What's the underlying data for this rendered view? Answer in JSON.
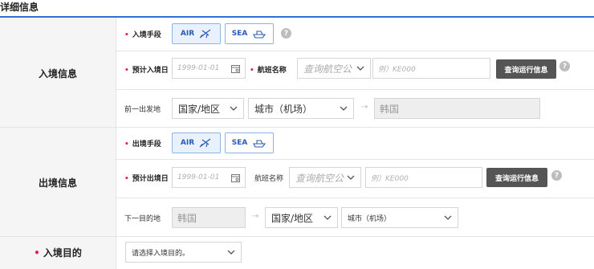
{
  "title": "详细信息",
  "entry": {
    "section_label": "入境信息",
    "mode_label": "入境手段",
    "air_label": "AIR",
    "sea_label": "SEA",
    "date_label": "预计入境日",
    "date_placeholder": "1999-01-01",
    "flight_label": "航班名称",
    "airline_select": "查询航空公",
    "flight_placeholder": "例）KE000",
    "query_button": "查询运行信息",
    "prev_label": "前一出发地",
    "country_select": "国家/地区",
    "city_select": "城市（机场）",
    "dest_value": "韩国"
  },
  "exit": {
    "section_label": "出境信息",
    "mode_label": "出境手段",
    "air_label": "AIR",
    "sea_label": "SEA",
    "date_label": "预计出境日",
    "date_placeholder": "1999-01-01",
    "flight_label": "航班名称",
    "airline_select": "查询航空公",
    "flight_placeholder": "例）KE000",
    "query_button": "查询运行信息",
    "next_label": "下一目的地",
    "origin_value": "韩国",
    "country_select": "国家/地区",
    "city_select": "城市（机场）"
  },
  "purpose": {
    "section_label": "入境目的",
    "select_placeholder": "请选择入境目的。"
  },
  "icons": {
    "help": "?",
    "arrow": "→",
    "calendar": "calendar-icon",
    "plane": "plane-icon",
    "ship": "ship-icon",
    "chevron": "chevron-down-icon"
  },
  "colors": {
    "accent": "#2f6fd6",
    "required": "#e0245e",
    "query_bg": "#555555"
  }
}
